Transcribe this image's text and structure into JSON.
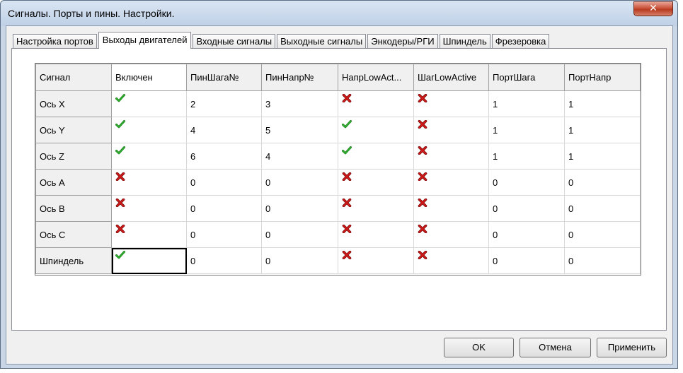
{
  "window": {
    "title": "Сигналы. Порты и пины. Настройки.",
    "close_glyph": "✕"
  },
  "tabs": [
    {
      "label": "Настройка портов"
    },
    {
      "label": "Выходы двигателей",
      "active": true
    },
    {
      "label": "Входные сигналы"
    },
    {
      "label": "Выходные сигналы"
    },
    {
      "label": "Энкодеры/РГИ"
    },
    {
      "label": "Шпиндель"
    },
    {
      "label": "Фрезеровка"
    }
  ],
  "grid": {
    "columns": [
      "Сигнал",
      "Включен",
      "ПинШага№",
      "ПинНапр№",
      "НапрLowAct...",
      "ШагLowActive",
      "ПортШага",
      "ПортНапр"
    ],
    "rows": [
      {
        "signal": "Ось X",
        "enabled": true,
        "step_pin": "2",
        "dir_pin": "3",
        "dir_low_active": false,
        "step_low_active": false,
        "step_port": "1",
        "dir_port": "1"
      },
      {
        "signal": "Ось Y",
        "enabled": true,
        "step_pin": "4",
        "dir_pin": "5",
        "dir_low_active": true,
        "step_low_active": false,
        "step_port": "1",
        "dir_port": "1"
      },
      {
        "signal": "Ось Z",
        "enabled": true,
        "step_pin": "6",
        "dir_pin": "4",
        "dir_low_active": true,
        "step_low_active": false,
        "step_port": "1",
        "dir_port": "1"
      },
      {
        "signal": "Ось A",
        "enabled": false,
        "step_pin": "0",
        "dir_pin": "0",
        "dir_low_active": false,
        "step_low_active": false,
        "step_port": "0",
        "dir_port": "0"
      },
      {
        "signal": "Ось B",
        "enabled": false,
        "step_pin": "0",
        "dir_pin": "0",
        "dir_low_active": false,
        "step_low_active": false,
        "step_port": "0",
        "dir_port": "0"
      },
      {
        "signal": "Ось C",
        "enabled": false,
        "step_pin": "0",
        "dir_pin": "0",
        "dir_low_active": false,
        "step_low_active": false,
        "step_port": "0",
        "dir_port": "0"
      },
      {
        "signal": "Шпиндель",
        "enabled": true,
        "step_pin": "0",
        "dir_pin": "0",
        "dir_low_active": false,
        "step_low_active": false,
        "step_port": "0",
        "dir_port": "0"
      }
    ],
    "icons": {
      "true": "green-check-icon",
      "false": "red-x-icon"
    },
    "colors": {
      "check": "#2fb52f",
      "cross": "#d01818"
    }
  },
  "buttons": {
    "ok": "OK",
    "cancel": "Отмена",
    "apply": "Применить"
  }
}
